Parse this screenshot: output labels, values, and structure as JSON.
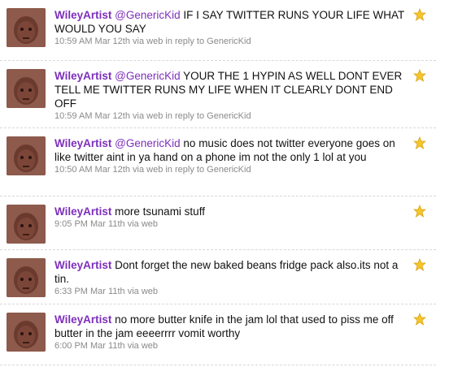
{
  "tweets": [
    {
      "author": "WileyArtist",
      "mention": "@GenericKid",
      "text": " IF I SAY TWITTER RUNS YOUR LIFE WHAT WOULD YOU SAY",
      "time": "10:59 AM Mar 12th",
      "via_label": "via",
      "via": "web",
      "reply_label": "in reply to",
      "reply_to": "GenericKid"
    },
    {
      "author": "WileyArtist",
      "mention": "@GenericKid",
      "text": " YOUR THE 1 HYPIN AS WELL DONT EVER TELL ME TWITTER RUNS MY LIFE WHEN IT CLEARLY DONT END OFF",
      "time": "10:59 AM Mar 12th",
      "via_label": "via",
      "via": "web",
      "reply_label": "in reply to",
      "reply_to": "GenericKid"
    },
    {
      "author": "WileyArtist",
      "mention": "@GenericKid",
      "text": " no music does not twitter everyone goes on like twitter aint in ya hand on a phone im not the only 1 lol at you",
      "time": "10:50 AM Mar 12th",
      "via_label": "via",
      "via": "web",
      "reply_label": "in reply to",
      "reply_to": "GenericKid"
    },
    {
      "author": "WileyArtist",
      "text": " more tsunami stuff",
      "time": "9:05 PM Mar 11th",
      "via_label": "via",
      "via": "web"
    },
    {
      "author": "WileyArtist",
      "text": " Dont forget the new baked beans fridge pack also.its not a tin.",
      "time": "6:33 PM Mar 11th",
      "via_label": "via",
      "via": "web"
    },
    {
      "author": "WileyArtist",
      "text": " no more butter knife in the jam lol that used to piss me off butter in the jam eeeerrrr vomit worthy",
      "time": "6:00 PM Mar 11th",
      "via_label": "via",
      "via": "web"
    }
  ],
  "icons": {
    "avatar": "avatar",
    "favorite": "star-icon"
  },
  "colors": {
    "link": "#7d2fbb",
    "meta": "#8a8a8a",
    "star": "#f6c42b",
    "divider": "#d7d7d7"
  }
}
